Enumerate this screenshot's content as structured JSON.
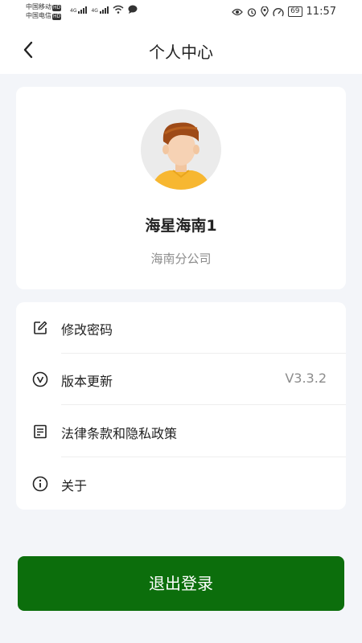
{
  "status_bar": {
    "carrier1": "中国移动",
    "carrier2": "中国电信",
    "hd": "HD",
    "net": "4G",
    "battery": "69",
    "time": "11:57"
  },
  "header": {
    "title": "个人中心"
  },
  "profile": {
    "name": "海星海南1",
    "company": "海南分公司"
  },
  "menu": {
    "items": [
      {
        "label": "修改密码",
        "icon": "edit-icon"
      },
      {
        "label": "版本更新",
        "value": "V3.3.2",
        "icon": "version-icon"
      },
      {
        "label": "法律条款和隐私政策",
        "icon": "document-icon"
      },
      {
        "label": "关于",
        "icon": "info-icon"
      }
    ]
  },
  "logout": {
    "label": "退出登录"
  },
  "colors": {
    "accent": "#0c6e0c",
    "background": "#f3f5f9"
  }
}
